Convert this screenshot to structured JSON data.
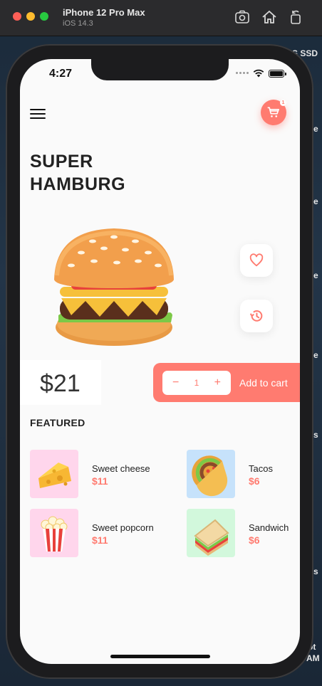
{
  "simulator": {
    "title": "iPhone 12 Pro Max",
    "subtitle": "iOS 14.3",
    "icons": [
      "screenshot-icon",
      "home-icon",
      "rotate-icon"
    ]
  },
  "desktop": {
    "fragments": [
      "S SSD",
      "e",
      "e",
      "e",
      "e",
      "s",
      "s",
      "ot",
      "AM"
    ]
  },
  "status_bar": {
    "time": "4:27"
  },
  "header": {
    "cart_count": "1"
  },
  "product": {
    "title": "SUPER HAMBURG",
    "price": "$21",
    "quantity": "1",
    "add_to_cart_label": "Add to cart",
    "decrement_symbol": "−",
    "increment_symbol": "+"
  },
  "featured": {
    "heading": "FEATURED",
    "items": [
      {
        "name": "Sweet cheese",
        "price": "$11",
        "bg": "#ffd6ec",
        "icon": "cheese-icon"
      },
      {
        "name": "Tacos",
        "price": "$6",
        "bg": "#c6e2fb",
        "icon": "taco-icon"
      },
      {
        "name": "Sweet popcorn",
        "price": "$11",
        "bg": "#ffd6ec",
        "icon": "popcorn-icon"
      },
      {
        "name": "Sandwich",
        "price": "$6",
        "bg": "#d2f8dc",
        "icon": "sandwich-icon"
      }
    ]
  },
  "colors": {
    "accent": "#ff7b70",
    "background": "#fafafa",
    "text": "#222222"
  }
}
